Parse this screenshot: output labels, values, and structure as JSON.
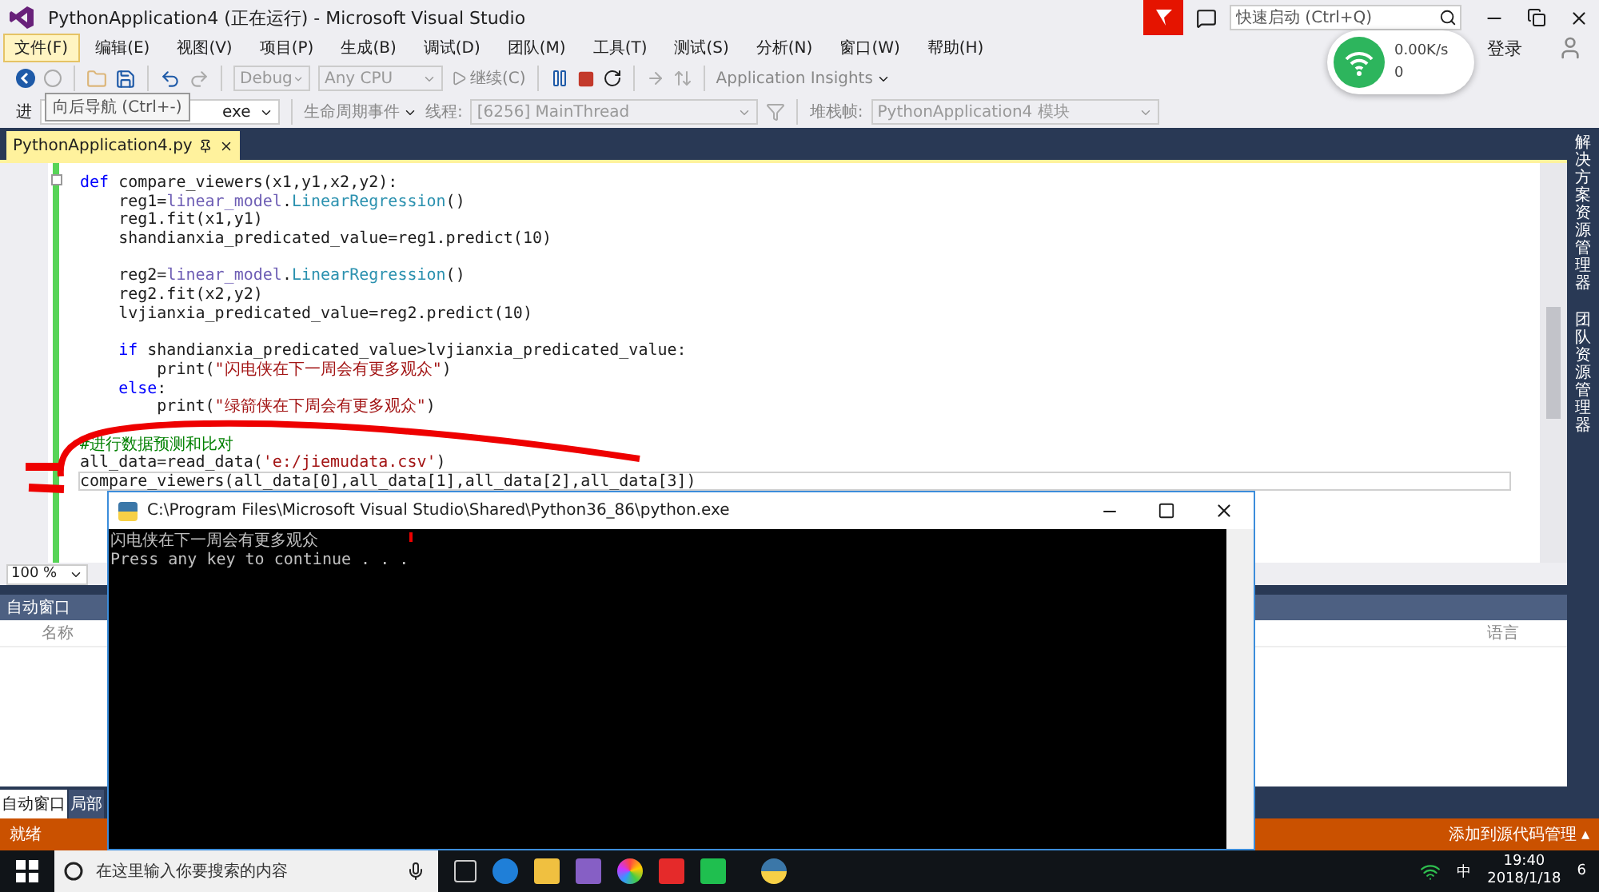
{
  "window": {
    "title": "PythonApplication4 (正在运行) - Microsoft Visual Studio",
    "quick_launch": {
      "placeholder": "快速启动 (Ctrl+Q)"
    },
    "sign_in": "登录"
  },
  "menu": [
    {
      "label": "文件(F)",
      "selected": true
    },
    {
      "label": "编辑(E)",
      "selected": false
    },
    {
      "label": "视图(V)",
      "selected": false
    },
    {
      "label": "项目(P)",
      "selected": false
    },
    {
      "label": "生成(B)",
      "selected": false
    },
    {
      "label": "调试(D)",
      "selected": false
    },
    {
      "label": "团队(M)",
      "selected": false
    },
    {
      "label": "工具(T)",
      "selected": false
    },
    {
      "label": "测试(S)",
      "selected": false
    },
    {
      "label": "分析(N)",
      "selected": false
    },
    {
      "label": "窗口(W)",
      "selected": false
    },
    {
      "label": "帮助(H)",
      "selected": false
    }
  ],
  "network_widget": {
    "speed": "0.00K/s",
    "count": "0"
  },
  "toolbar": {
    "configuration": "Debug",
    "platform": "Any CPU",
    "continue": "继续(C)",
    "insights": "Application Insights"
  },
  "debug_location": {
    "process_label": "进",
    "process_value": "exe",
    "lifecycle": "生命周期事件",
    "thread_label": "线程:",
    "thread_value": "[6256] MainThread",
    "stack_label": "堆栈帧:",
    "stack_value": "PythonApplication4 模块"
  },
  "tooltip": "向后导航 (Ctrl+-)",
  "document_tabs": [
    {
      "label": "PythonApplication4.py",
      "selected": true
    }
  ],
  "editor": {
    "zoom": "100 %",
    "lines": [
      {
        "current": false,
        "segments": [
          {
            "kind": "keyword",
            "text": "def"
          },
          {
            "kind": "plain",
            "text": " compare_viewers(x1,y1,x2,y2):"
          }
        ]
      },
      {
        "current": false,
        "segments": [
          {
            "kind": "plain",
            "text": "    reg1="
          },
          {
            "kind": "module",
            "text": "linear_model"
          },
          {
            "kind": "plain",
            "text": "."
          },
          {
            "kind": "type",
            "text": "LinearRegression"
          },
          {
            "kind": "plain",
            "text": "()"
          }
        ]
      },
      {
        "current": false,
        "segments": [
          {
            "kind": "plain",
            "text": "    reg1.fit(x1,y1)"
          }
        ]
      },
      {
        "current": false,
        "segments": [
          {
            "kind": "plain",
            "text": "    shandianxia_predicated_value=reg1.predict(10)"
          }
        ]
      },
      {
        "current": false
      },
      {
        "current": false,
        "segments": [
          {
            "kind": "plain",
            "text": "    reg2="
          },
          {
            "kind": "module",
            "text": "linear_model"
          },
          {
            "kind": "plain",
            "text": "."
          },
          {
            "kind": "type",
            "text": "LinearRegression"
          },
          {
            "kind": "plain",
            "text": "()"
          }
        ]
      },
      {
        "current": false,
        "segments": [
          {
            "kind": "plain",
            "text": "    reg2.fit(x2,y2)"
          }
        ]
      },
      {
        "current": false,
        "segments": [
          {
            "kind": "plain",
            "text": "    lvjianxia_predicated_value=reg2.predict(10)"
          }
        ]
      },
      {
        "current": false
      },
      {
        "current": false,
        "segments": [
          {
            "kind": "keyword",
            "text": "    if"
          },
          {
            "kind": "plain",
            "text": " shandianxia_predicated_value>lvjianxia_predicated_value:"
          }
        ]
      },
      {
        "current": false,
        "segments": [
          {
            "kind": "plain",
            "text": "        print("
          },
          {
            "kind": "string",
            "text": "\"闪电侠在下一周会有更多观众\""
          },
          {
            "kind": "plain",
            "text": ")"
          }
        ]
      },
      {
        "current": false,
        "segments": [
          {
            "kind": "keyword",
            "text": "    else"
          },
          {
            "kind": "plain",
            "text": ":"
          }
        ]
      },
      {
        "current": false,
        "segments": [
          {
            "kind": "plain",
            "text": "        print("
          },
          {
            "kind": "string",
            "text": "\"绿箭侠在下周会有更多观众\""
          },
          {
            "kind": "plain",
            "text": ")"
          }
        ]
      },
      {
        "current": false
      },
      {
        "current": false,
        "segments": [
          {
            "kind": "comment",
            "text": "#进行数据预测和比对"
          }
        ]
      },
      {
        "current": false,
        "segments": [
          {
            "kind": "plain",
            "text": "all_data=read_data("
          },
          {
            "kind": "string",
            "text": "'e:/jiemudata.csv'"
          },
          {
            "kind": "plain",
            "text": ")"
          }
        ]
      },
      {
        "current": true,
        "segments": [
          {
            "kind": "plain",
            "text": "compare_viewers(all_data[0],all_data[1],all_data[2],all_data[3])"
          }
        ]
      }
    ]
  },
  "side_tabs": [
    "解决方案资源管理器",
    "团队资源管理器"
  ],
  "autos_panel": {
    "title": "自动窗口",
    "columns": [
      "名称",
      "语言"
    ],
    "tabs": [
      {
        "label": "自动窗口",
        "selected": true
      },
      {
        "label": "局部",
        "selected": false
      }
    ]
  },
  "console": {
    "title": "C:\\Program Files\\Microsoft Visual Studio\\Shared\\Python36_86\\python.exe",
    "lines": [
      "闪电侠在下一周会有更多观众",
      "Press any key to continue . . ."
    ]
  },
  "status_bar": {
    "state": "就绪",
    "source_control": "添加到源代码管理",
    "caret": "▴"
  },
  "taskbar": {
    "search": {
      "placeholder": "在这里输入你要搜索的内容"
    },
    "input_method": "中",
    "time": "19:40",
    "date": "2018/1/18",
    "notifications": "6"
  }
}
